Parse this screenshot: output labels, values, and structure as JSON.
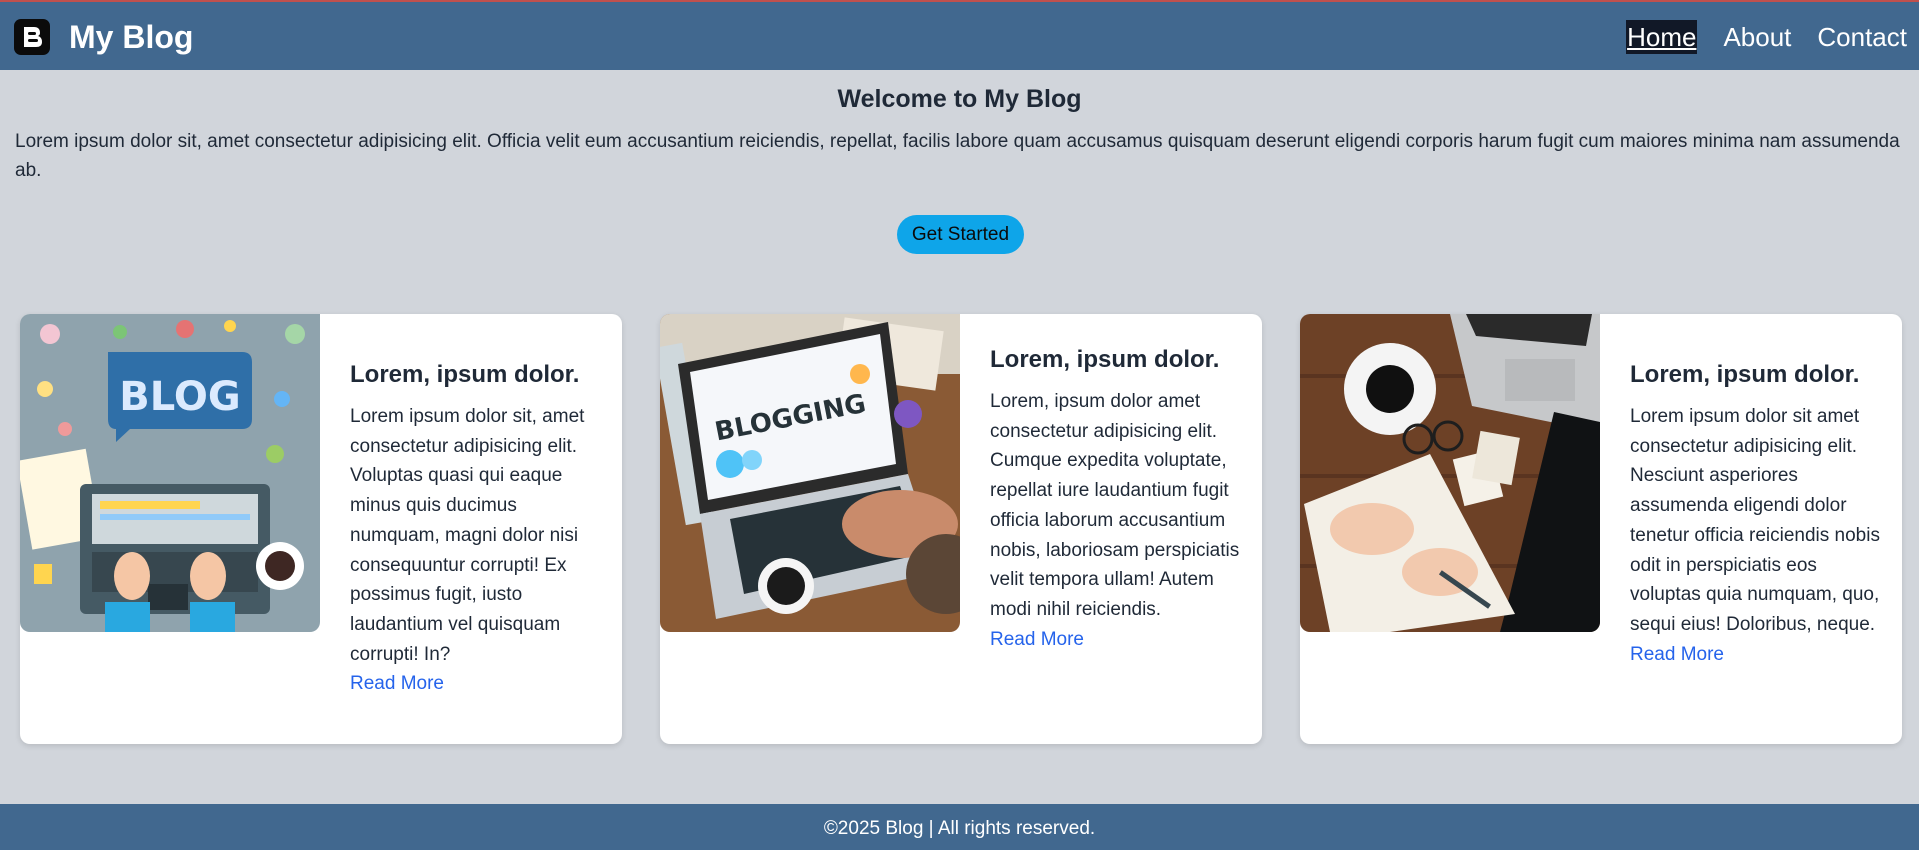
{
  "header": {
    "brand": "My Blog",
    "logo_icon": "blogger-logo-icon",
    "nav": [
      {
        "label": "Home",
        "active": true
      },
      {
        "label": "About",
        "active": false
      },
      {
        "label": "Contact",
        "active": false
      }
    ]
  },
  "hero": {
    "title": "Welcome to My Blog",
    "text": "Lorem ipsum dolor sit, amet consectetur adipisicing elit. Officia velit eum accusantium reiciendis, repellat, facilis labore quam accusamus quisquam deserunt eligendi corporis harum fugit cum maiores minima nam assumenda ab.",
    "cta_label": "Get Started"
  },
  "cards": [
    {
      "title": "Lorem, ipsum dolor.",
      "text": "Lorem ipsum dolor sit, amet consectetur adipisicing elit. Voluptas quasi qui eaque minus quis ducimus numquam, magni dolor nisi consequuntur corrupti! Ex possimus fugit, iusto laudantium vel quisquam corrupti! In?",
      "link": "Read More",
      "image": "blog-illustration-image",
      "image_text": "BLOG"
    },
    {
      "title": "Lorem, ipsum dolor.",
      "text": "Lorem, ipsum dolor amet consectetur adipisicing elit. Cumque expedita voluptate, repellat iure laudantium fugit officia laborum accusantium nobis, laboriosam perspiciatis velit tempora ullam! Autem modi nihil reiciendis.",
      "link": "Read More",
      "image": "blogging-laptop-photo",
      "image_text": "BLOGGING"
    },
    {
      "title": "Lorem, ipsum dolor.",
      "text": "Lorem ipsum dolor sit amet consectetur adipisicing elit. Nesciunt asperiores assumenda eligendi dolor tenetur officia reiciendis nobis odit in perspiciatis eos voluptas quia numquam, quo, sequi eius! Doloribus, neque.",
      "link": "Read More",
      "image": "desk-writing-photo"
    }
  ],
  "footer": {
    "text": "©2025 Blog | All rights reserved."
  },
  "colors": {
    "header_bg": "#41688f",
    "page_bg": "#d1d5db",
    "cta_bg": "#0ea5e9",
    "link": "#2563eb",
    "active_nav_bg": "#111827"
  }
}
